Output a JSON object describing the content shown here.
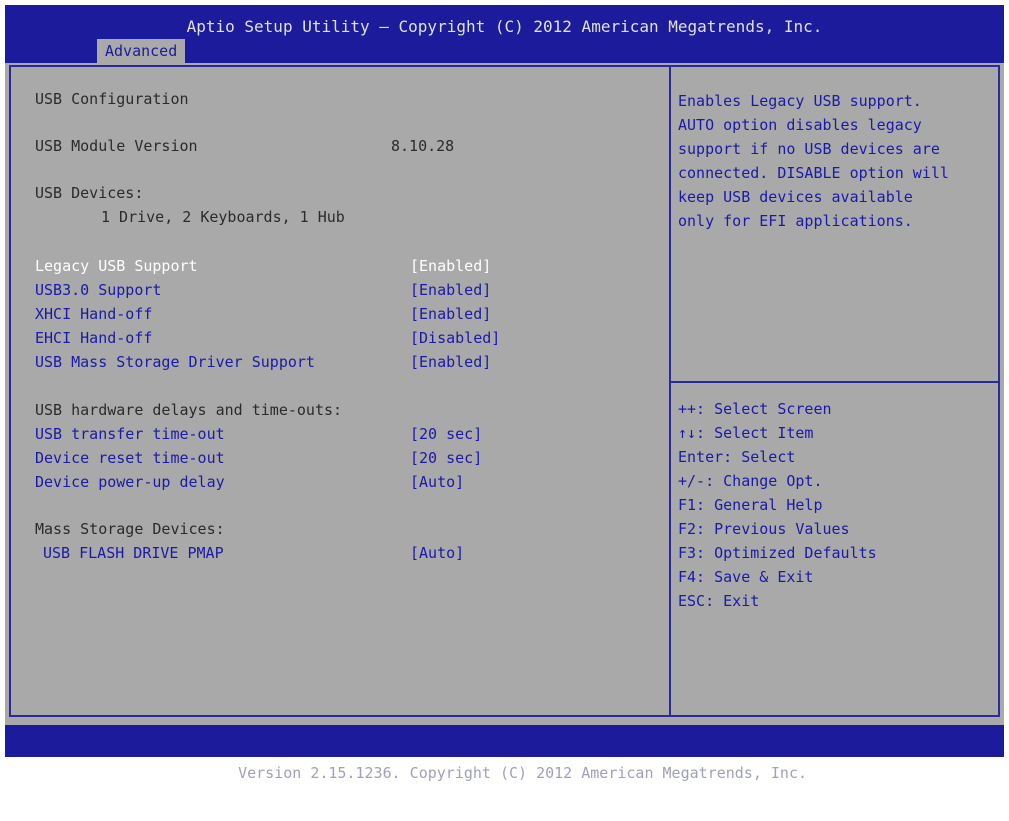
{
  "header": {
    "title": "Aptio Setup Utility – Copyright (C) 2012 American Megatrends, Inc.",
    "tab": "Advanced"
  },
  "main": {
    "heading": "USB Configuration",
    "module_label": "USB Module Version",
    "module_value": "8.10.28",
    "devices_label": "USB Devices:",
    "devices_value": "1 Drive, 2 Keyboards, 1 Hub",
    "options": [
      {
        "label": "Legacy USB Support",
        "value": "[Enabled]"
      },
      {
        "label": "USB3.0 Support",
        "value": "[Enabled]"
      },
      {
        "label": "XHCI Hand-off",
        "value": "[Enabled]"
      },
      {
        "label": "EHCI Hand-off",
        "value": "[Disabled]"
      },
      {
        "label": "USB Mass Storage Driver Support",
        "value": "[Enabled]"
      }
    ],
    "delays_heading": "USB hardware delays and time-outs:",
    "delays": [
      {
        "label": "USB transfer time-out",
        "value": "[20 sec]"
      },
      {
        "label": "Device reset time-out",
        "value": "[20 sec]"
      },
      {
        "label": "Device power-up delay",
        "value": "[Auto]"
      }
    ],
    "mass_heading": "Mass Storage Devices:",
    "mass_device": {
      "label": "USB FLASH DRIVE PMAP",
      "value": "[Auto]"
    }
  },
  "help": {
    "lines": [
      "Enables Legacy USB support.",
      "AUTO option disables legacy",
      "support if no USB devices are",
      "connected. DISABLE option will",
      "keep USB devices available",
      "only for EFI applications."
    ]
  },
  "keys": [
    "++: Select Screen",
    "↑↓: Select Item",
    "Enter: Select",
    "+/-: Change Opt.",
    "F1: General Help",
    "F2: Previous Values",
    "F3: Optimized Defaults",
    "F4: Save & Exit",
    "ESC: Exit"
  ],
  "footer": {
    "text": "Version 2.15.1236. Copyright (C) 2012 American Megatrends, Inc."
  }
}
